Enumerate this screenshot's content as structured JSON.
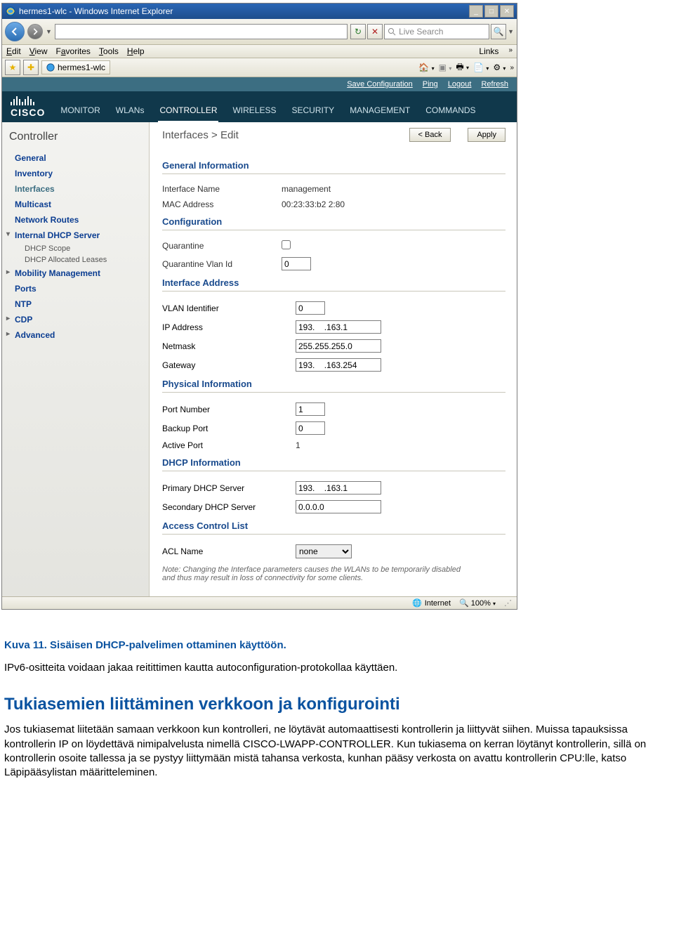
{
  "ie": {
    "title": "hermes1-wlc - Windows Internet Explorer",
    "tab_label": "hermes1-wlc",
    "search_placeholder": "Live Search",
    "menus": {
      "edit": "Edit",
      "view": "View",
      "favorites": "Favorites",
      "tools": "Tools",
      "help": "Help",
      "links": "Links"
    },
    "status": {
      "zone": "Internet",
      "zoom": "100%"
    }
  },
  "wlc": {
    "top_links": {
      "save": "Save Configuration",
      "ping": "Ping",
      "logout": "Logout",
      "refresh": "Refresh"
    },
    "tabs": {
      "monitor": "MONITOR",
      "wlans": "WLANs",
      "controller": "CONTROLLER",
      "wireless": "WIRELESS",
      "security": "SECURITY",
      "management": "MANAGEMENT",
      "commands": "COMMANDS"
    },
    "sidebar": {
      "title": "Controller",
      "items": {
        "general": "General",
        "inventory": "Inventory",
        "interfaces": "Interfaces",
        "multicast": "Multicast",
        "network_routes": "Network Routes",
        "internal_dhcp": "Internal DHCP Server",
        "dhcp_scope": "DHCP Scope",
        "dhcp_alloc": "DHCP Allocated Leases",
        "mobility": "Mobility Management",
        "ports": "Ports",
        "ntp": "NTP",
        "cdp": "CDP",
        "advanced": "Advanced"
      }
    },
    "breadcrumb": "Interfaces > Edit",
    "buttons": {
      "back": "< Back",
      "apply": "Apply"
    },
    "sections": {
      "general": "General Information",
      "config": "Configuration",
      "iface": "Interface Address",
      "phys": "Physical Information",
      "dhcp": "DHCP Information",
      "acl": "Access Control List"
    },
    "labels": {
      "iface_name": "Interface Name",
      "mac": "MAC Address",
      "quarantine": "Quarantine",
      "quarantine_vlan": "Quarantine Vlan Id",
      "vlan": "VLAN Identifier",
      "ip": "IP Address",
      "netmask": "Netmask",
      "gateway": "Gateway",
      "port_num": "Port Number",
      "backup_port": "Backup Port",
      "active_port": "Active Port",
      "primary_dhcp": "Primary DHCP Server",
      "secondary_dhcp": "Secondary DHCP Server",
      "acl_name": "ACL Name"
    },
    "values": {
      "iface_name": "management",
      "mac": "00:23:33:b2   2:80",
      "quarantine_vlan": "0",
      "vlan": "0",
      "ip": "193.    .163.1",
      "netmask": "255.255.255.0",
      "gateway": "193.    .163.254",
      "port_num": "1",
      "backup_port": "0",
      "active_port": "1",
      "primary_dhcp": "193.    .163.1",
      "secondary_dhcp": "0.0.0.0",
      "acl_name": "none"
    },
    "note": "Note: Changing the Interface parameters causes the WLANs to be temporarily disabled and thus may result in loss of connectivity for some clients."
  },
  "doc": {
    "caption": "Kuva 11. Sisäisen DHCP-palvelimen ottaminen käyttöön.",
    "p1": "IPv6-ositteita voidaan jakaa reitittimen kautta autoconfiguration-protokollaa käyttäen.",
    "h2": "Tukiasemien liittäminen verkkoon ja konfigurointi",
    "p2": "Jos tukiasemat liitetään samaan verkkoon kun kontrolleri, ne löytävät automaattisesti kontrollerin ja liittyvät siihen. Muissa tapauksissa kontrollerin IP on löydettävä nimipalvelusta nimellä CISCO-LWAPP-CONTROLLER. Kun tukiasema on kerran löytänyt kontrollerin, sillä on kontrollerin osoite tallessa ja se pystyy liittymään mistä tahansa verkosta, kunhan pääsy verkosta on avattu kontrollerin CPU:lle, katso Läpipääsylistan määritteleminen."
  }
}
